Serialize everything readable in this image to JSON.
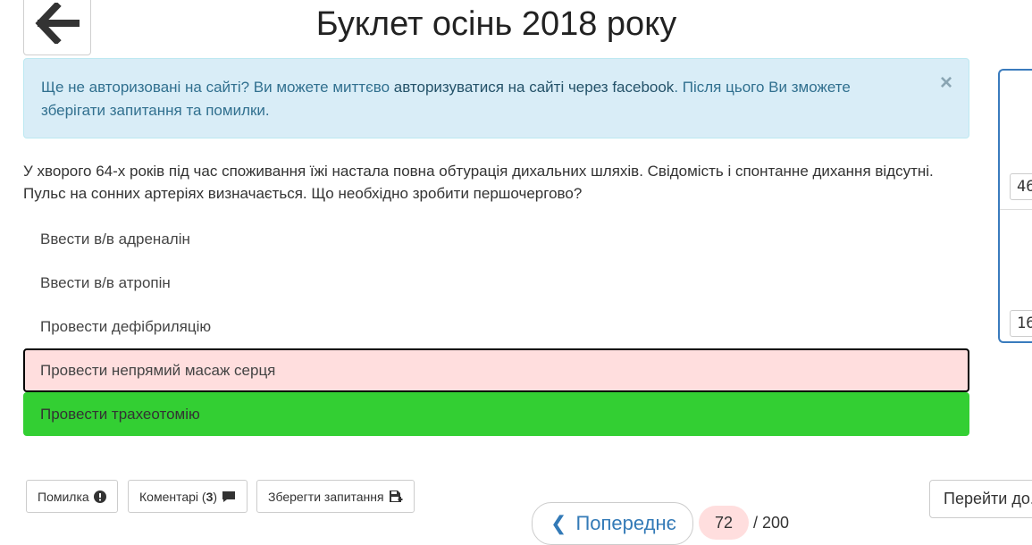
{
  "header": {
    "title": "Буклет осінь 2018 року"
  },
  "alert": {
    "text_before": "Ще не авторизовані на сайті? Ви можете миттєво ",
    "link": "авторизуватися на сайті через facebook",
    "text_after": ". Після цього Ви зможете зберігати запитання та помилки.",
    "close": "×"
  },
  "question": {
    "text": "У хворого 64-х років під час споживання їжі настала повна обтурація дихальних шляхів. Свідомість і спонтанне дихання відсутні. Пульс на сонних артеріях визначається. Що необхідно зробити першочергово?"
  },
  "answers": [
    {
      "label": "Ввести в/в адреналін",
      "state": "none"
    },
    {
      "label": "Ввести в/в атропін",
      "state": "none"
    },
    {
      "label": "Провести дефібриляцію",
      "state": "none"
    },
    {
      "label": "Провести непрямий масаж серця",
      "state": "wrong"
    },
    {
      "label": "Провести трахеотомію",
      "state": "correct"
    }
  ],
  "side_panel": {
    "value_top": "46",
    "value_bottom": "16"
  },
  "actions": {
    "error_label": "Помилка",
    "comments_label": "Коментарі (",
    "comments_count": "3",
    "comments_close": ")",
    "save_label": "Зберегти запитання"
  },
  "pagination": {
    "prev_label": "Попереднє",
    "current_page": "72",
    "total_label": "/ 200",
    "goto_label": "Перейти до..."
  },
  "colors": {
    "correct": "#33cf33",
    "wrong": "#ffdede",
    "accent": "#337ab7",
    "alert_bg": "#d9edf7"
  }
}
